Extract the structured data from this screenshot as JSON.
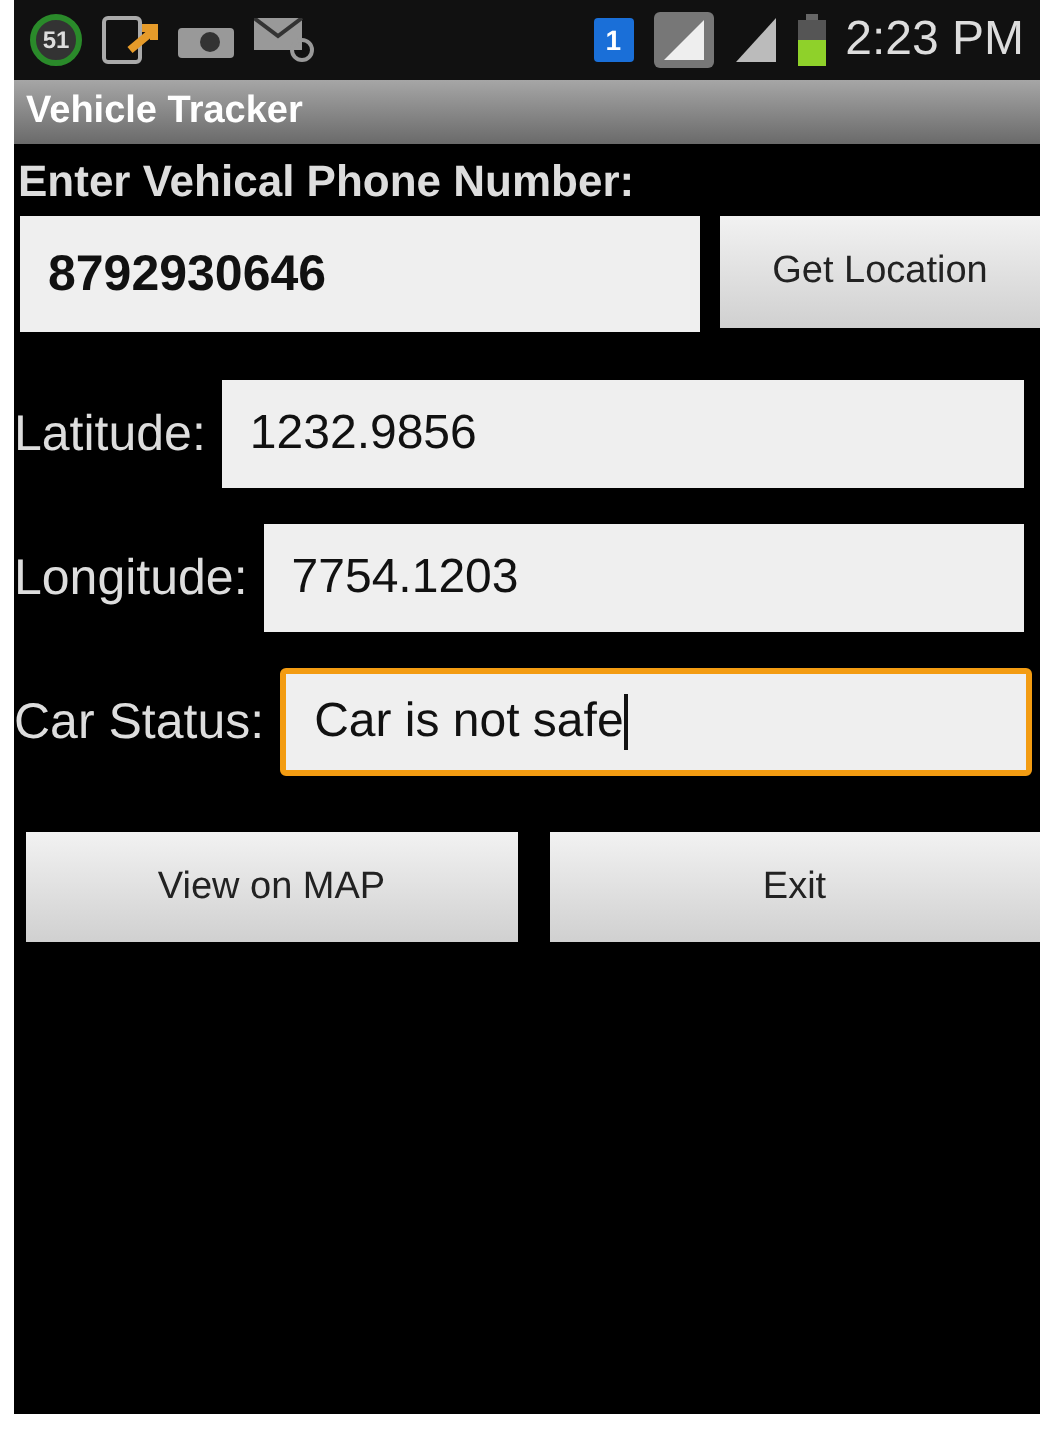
{
  "status_bar": {
    "notification_count": "51",
    "sim_slot": "1",
    "time": "2:23 PM"
  },
  "title_bar": {
    "title": "Vehicle Tracker"
  },
  "phone": {
    "label": "Enter Vehical Phone Number:",
    "value": "8792930646",
    "button": "Get Location"
  },
  "fields": [
    {
      "label": "Latitude:",
      "value": "1232.9856",
      "focused": false
    },
    {
      "label": "Longitude:",
      "value": "7754.1203",
      "focused": false
    },
    {
      "label": "Car Status:",
      "value": "Car is not safe",
      "focused": true
    }
  ],
  "buttons": [
    "View on MAP",
    "Exit"
  ]
}
